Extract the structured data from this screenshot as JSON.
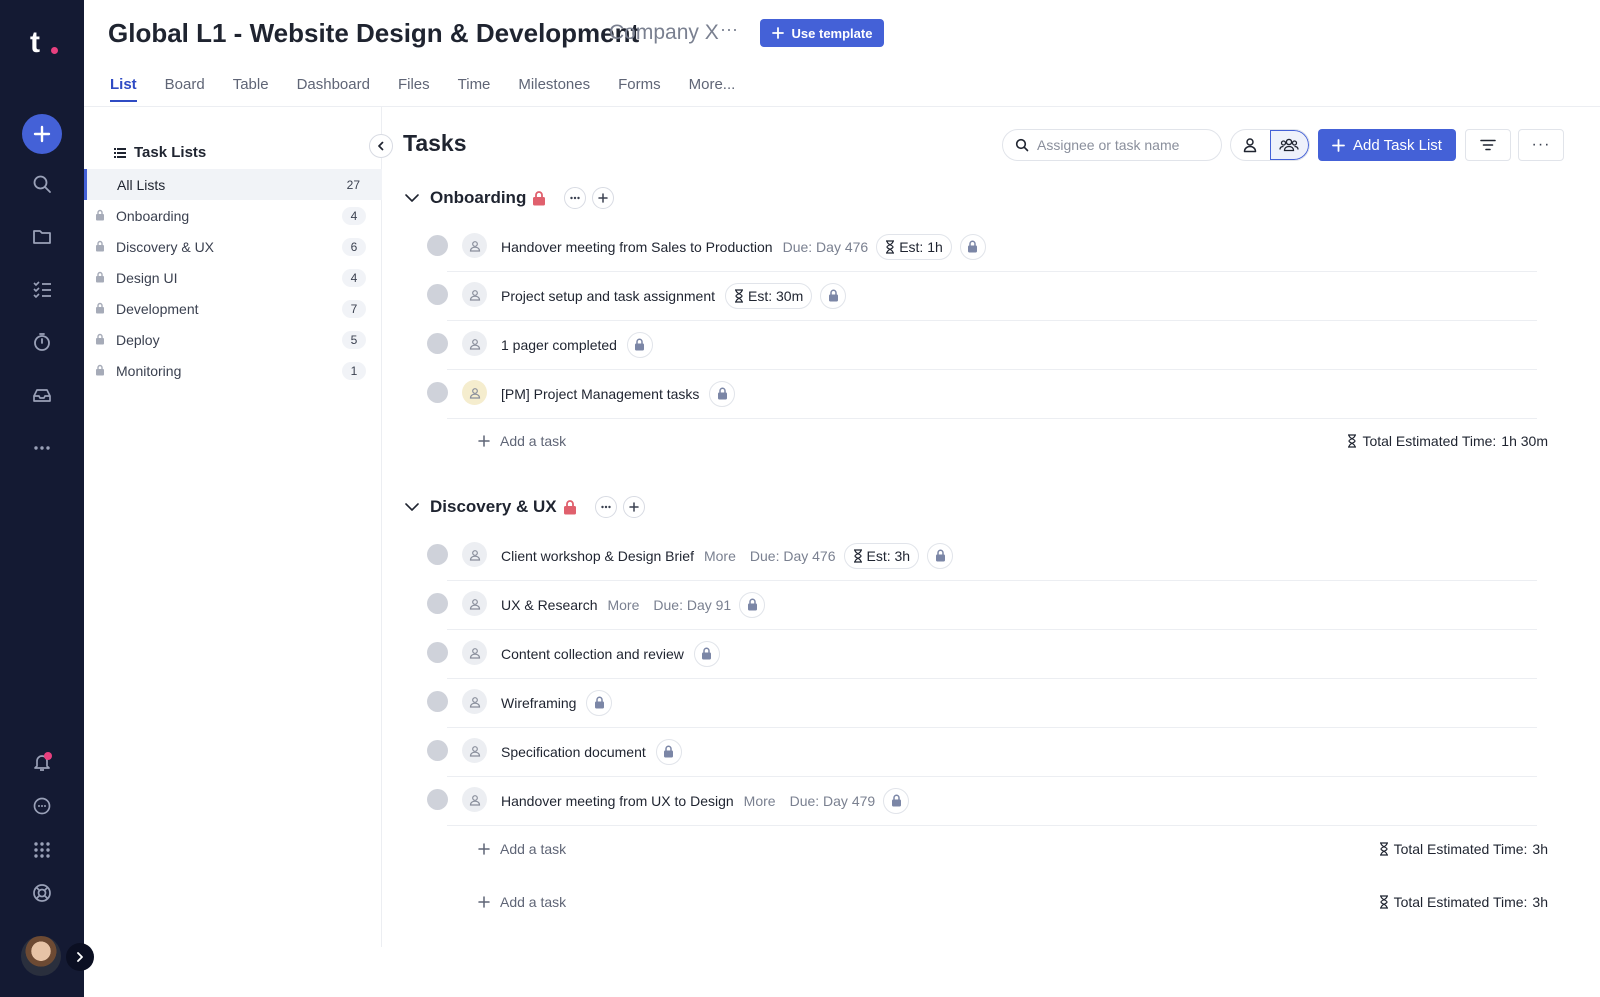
{
  "app": {
    "logo_text": "t"
  },
  "header": {
    "title": "Global L1 - Website Design & Development",
    "company": "Company X",
    "more_label": "···",
    "use_template_label": "Use template"
  },
  "tabs": [
    {
      "label": "List",
      "active": true
    },
    {
      "label": "Board"
    },
    {
      "label": "Table"
    },
    {
      "label": "Dashboard"
    },
    {
      "label": "Files"
    },
    {
      "label": "Time"
    },
    {
      "label": "Milestones"
    },
    {
      "label": "Forms"
    },
    {
      "label": "More..."
    }
  ],
  "sidebar": {
    "title": "Task Lists",
    "items": [
      {
        "label": "All Lists",
        "count": "27",
        "active": true
      },
      {
        "label": "Onboarding",
        "count": "4"
      },
      {
        "label": "Discovery & UX",
        "count": "6"
      },
      {
        "label": "Design UI",
        "count": "4"
      },
      {
        "label": "Development",
        "count": "7"
      },
      {
        "label": "Deploy",
        "count": "5"
      },
      {
        "label": "Monitoring",
        "count": "1"
      }
    ]
  },
  "main": {
    "title": "Tasks",
    "search_placeholder": "Assignee or task name",
    "add_task_list_label": "Add Task List",
    "more_label": "···",
    "add_task_label": "Add a task",
    "total_est_prefix": "Total Estimated Time:",
    "groups": [
      {
        "name": "Onboarding",
        "tasks": [
          {
            "name": "Handover meeting from Sales to Production",
            "due": "Due: Day 476",
            "est": "Est: 1h"
          },
          {
            "name": "Project setup and task assignment",
            "est": "Est: 30m"
          },
          {
            "name": "1 pager completed"
          },
          {
            "name": "[PM] Project Management tasks"
          }
        ],
        "total_est": "1h 30m"
      },
      {
        "name": "Discovery & UX",
        "tasks": [
          {
            "name": "Client workshop & Design Brief",
            "more": "More",
            "due": "Due: Day 476",
            "est": "Est: 3h"
          },
          {
            "name": "UX & Research",
            "more": "More",
            "due": "Due: Day 91"
          },
          {
            "name": "Content collection and review"
          },
          {
            "name": "Wireframing"
          },
          {
            "name": "Specification document"
          },
          {
            "name": "Handover meeting from UX to Design",
            "more": "More",
            "due": "Due: Day 479"
          }
        ],
        "total_est": "3h"
      }
    ],
    "footer": {
      "add_task_label": "Add a task",
      "total_est": "3h"
    }
  },
  "colors": {
    "rail_bg": "#141a33",
    "accent": "#4461d7",
    "notification": "#e8407f",
    "lock_red": "#e0606d"
  }
}
